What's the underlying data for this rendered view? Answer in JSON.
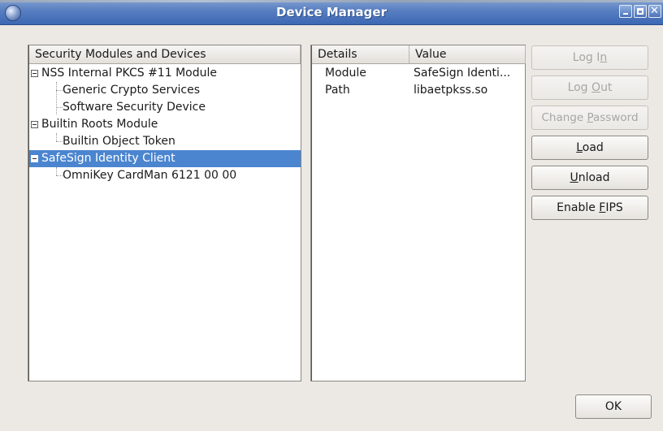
{
  "window": {
    "title": "Device Manager"
  },
  "tree": {
    "header": "Security Modules and Devices",
    "rows": [
      {
        "label": "NSS Internal PKCS #11 Module",
        "level": 0,
        "expanded": true
      },
      {
        "label": "Generic Crypto Services",
        "level": 1
      },
      {
        "label": "Software Security Device",
        "level": 1
      },
      {
        "label": "Builtin Roots Module",
        "level": 0,
        "expanded": true
      },
      {
        "label": "Builtin Object Token",
        "level": 1
      },
      {
        "label": "SafeSign Identity Client",
        "level": 0,
        "expanded": true,
        "selected": true
      },
      {
        "label": "OmniKey CardMan 6121 00 00",
        "level": 1
      }
    ]
  },
  "details": {
    "headers": [
      "Details",
      "Value"
    ],
    "rows": [
      {
        "detail": "Module",
        "value": "SafeSign Identi..."
      },
      {
        "detail": "Path",
        "value": "libaetpkss.so"
      }
    ]
  },
  "buttons": {
    "log_in": {
      "pre": "Log I",
      "mnemonic": "n",
      "post": "",
      "enabled": false
    },
    "log_out": {
      "pre": "Log ",
      "mnemonic": "O",
      "post": "ut",
      "enabled": false
    },
    "change_password": {
      "pre": "Change ",
      "mnemonic": "P",
      "post": "assword",
      "enabled": false
    },
    "load": {
      "pre": "",
      "mnemonic": "L",
      "post": "oad",
      "enabled": true
    },
    "unload": {
      "pre": "",
      "mnemonic": "U",
      "post": "nload",
      "enabled": true
    },
    "enable_fips": {
      "pre": "Enable ",
      "mnemonic": "F",
      "post": "IPS",
      "enabled": true
    },
    "ok": "OK"
  },
  "colors": {
    "titlebar": "#4a73b8",
    "selection": "#4b85cf",
    "disabled_text": "#a8a6a2"
  },
  "icons": {
    "app": "device-manager-icon",
    "minimize": "minimize-icon",
    "maximize": "maximize-icon",
    "close": "close-icon"
  }
}
